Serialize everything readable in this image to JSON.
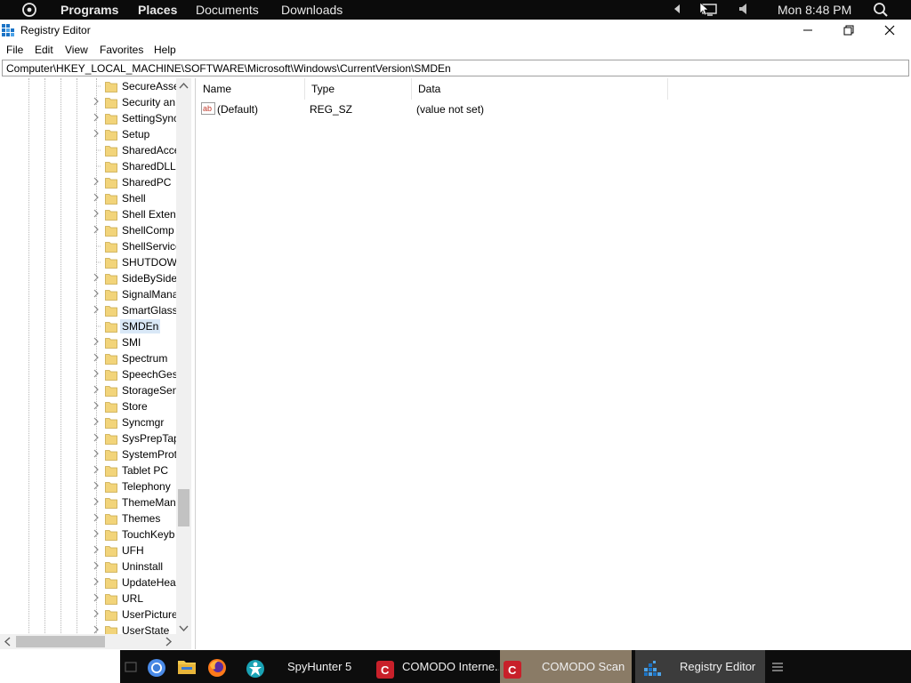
{
  "top_panel": {
    "programs": "Programs",
    "places": "Places",
    "documents": "Documents",
    "downloads": "Downloads",
    "clock": "Mon 8:48 PM"
  },
  "window": {
    "title": "Registry Editor",
    "menu": [
      "File",
      "Edit",
      "View",
      "Favorites",
      "Help"
    ],
    "address": "Computer\\HKEY_LOCAL_MACHINE\\SOFTWARE\\Microsoft\\Windows\\CurrentVersion\\SMDEn"
  },
  "tree": {
    "items": [
      {
        "label": "SecureAsse",
        "expander": false
      },
      {
        "label": "Security an",
        "expander": true
      },
      {
        "label": "SettingSync",
        "expander": true
      },
      {
        "label": "Setup",
        "expander": true
      },
      {
        "label": "SharedAcce",
        "expander": false
      },
      {
        "label": "SharedDLLs",
        "expander": false
      },
      {
        "label": "SharedPC",
        "expander": true
      },
      {
        "label": "Shell",
        "expander": true
      },
      {
        "label": "Shell Extens",
        "expander": true
      },
      {
        "label": "ShellComp",
        "expander": true
      },
      {
        "label": "ShellService",
        "expander": false
      },
      {
        "label": "SHUTDOWI",
        "expander": false
      },
      {
        "label": "SideBySide",
        "expander": true
      },
      {
        "label": "SignalMana",
        "expander": true
      },
      {
        "label": "SmartGlass",
        "expander": true
      },
      {
        "label": "SMDEn",
        "expander": false,
        "selected": true
      },
      {
        "label": "SMI",
        "expander": true
      },
      {
        "label": "Spectrum",
        "expander": true
      },
      {
        "label": "SpeechGest",
        "expander": true
      },
      {
        "label": "StorageSen",
        "expander": true
      },
      {
        "label": "Store",
        "expander": true
      },
      {
        "label": "Syncmgr",
        "expander": true
      },
      {
        "label": "SysPrepTap",
        "expander": true
      },
      {
        "label": "SystemProt",
        "expander": true
      },
      {
        "label": "Tablet PC",
        "expander": true
      },
      {
        "label": "Telephony",
        "expander": true
      },
      {
        "label": "ThemeMan",
        "expander": true
      },
      {
        "label": "Themes",
        "expander": true
      },
      {
        "label": "TouchKeyb",
        "expander": true
      },
      {
        "label": "UFH",
        "expander": true
      },
      {
        "label": "Uninstall",
        "expander": true
      },
      {
        "label": "UpdateHea",
        "expander": true
      },
      {
        "label": "URL",
        "expander": true
      },
      {
        "label": "UserPicture",
        "expander": true
      },
      {
        "label": "UserState",
        "expander": true
      }
    ]
  },
  "list": {
    "columns": [
      "Name",
      "Type",
      "Data"
    ],
    "rows": [
      {
        "name": "(Default)",
        "type": "REG_SZ",
        "data": "(value not set)"
      }
    ]
  },
  "taskbar": {
    "apps": [
      "SpyHunter 5",
      "COMODO Interne...",
      "COMODO Scan",
      "Registry Editor"
    ]
  },
  "colors": {
    "folder": "#f2d47a",
    "selection": "#d9e8f7",
    "panel": "#0b0b0b",
    "comodo_red": "#c8202a"
  }
}
